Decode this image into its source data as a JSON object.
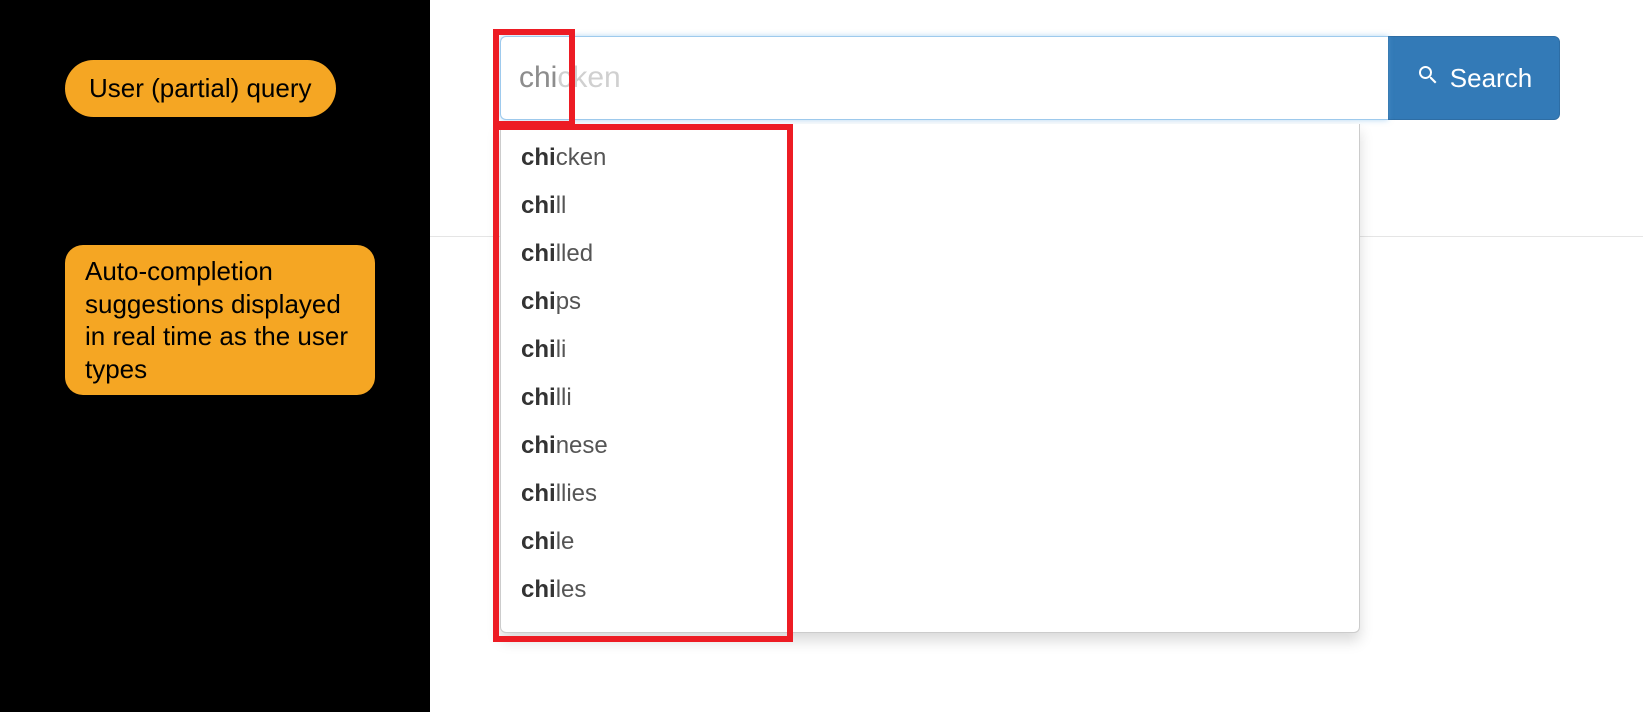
{
  "match_prefix": "chi",
  "search": {
    "typed": "chi",
    "ghost_completion": "cken",
    "button_label": "Search"
  },
  "callouts": {
    "query": "User (partial) query",
    "suggestions": "Auto-completion suggestions displayed in real time as the user types"
  },
  "suggestions": [
    "chicken",
    "chill",
    "chilled",
    "chips",
    "chili",
    "chilli",
    "chinese",
    "chillies",
    "chile",
    "chiles"
  ],
  "colors": {
    "callout_bg": "#f5a623",
    "button_bg": "#337ab7",
    "highlight": "#ed1c24"
  }
}
